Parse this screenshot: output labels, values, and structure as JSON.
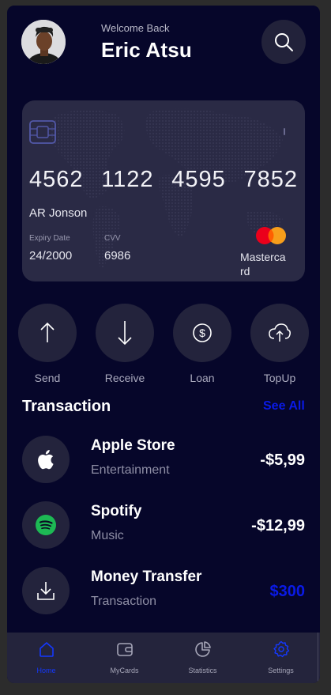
{
  "header": {
    "welcome": "Welcome Back",
    "user_name": "Eric Atsu",
    "avatar_icon": "user-avatar",
    "search_icon": "search-icon"
  },
  "card": {
    "number_groups": [
      "4562",
      "1122",
      "4595",
      "7852"
    ],
    "holder": "AR Jonson",
    "expiry_label": "Expiry Date",
    "expiry_value": "24/2000",
    "cvv_label": "CVV",
    "cvv_value": "6986",
    "brand": "Mastercard"
  },
  "actions": [
    {
      "label": "Send",
      "icon": "arrow-up-icon"
    },
    {
      "label": "Receive",
      "icon": "arrow-down-icon"
    },
    {
      "label": "Loan",
      "icon": "dollar-coin-icon"
    },
    {
      "label": "TopUp",
      "icon": "cloud-upload-icon"
    }
  ],
  "transactions": {
    "title": "Transaction",
    "see_all": "See All",
    "items": [
      {
        "name": "Apple Store",
        "category": "Entertainment",
        "amount": "-$5,99",
        "icon": "apple-icon",
        "amount_color": "#ffffff"
      },
      {
        "name": "Spotify",
        "category": "Music",
        "amount": "-$12,99",
        "icon": "spotify-icon",
        "amount_color": "#ffffff"
      },
      {
        "name": "Money Transfer",
        "category": "Transaction",
        "amount": "$300",
        "icon": "download-icon",
        "amount_color": "#0a1ae6"
      }
    ]
  },
  "tabbar": {
    "items": [
      {
        "label": "Home",
        "icon": "home-icon",
        "active": true
      },
      {
        "label": "MyCards",
        "icon": "wallet-icon",
        "active": false
      },
      {
        "label": "Statistics",
        "icon": "pie-chart-icon",
        "active": false
      },
      {
        "label": "Settings",
        "icon": "gear-icon",
        "active": false
      }
    ]
  },
  "colors": {
    "background": "#06062a",
    "accent": "#0a1ae6",
    "card": "#2a2a45"
  }
}
